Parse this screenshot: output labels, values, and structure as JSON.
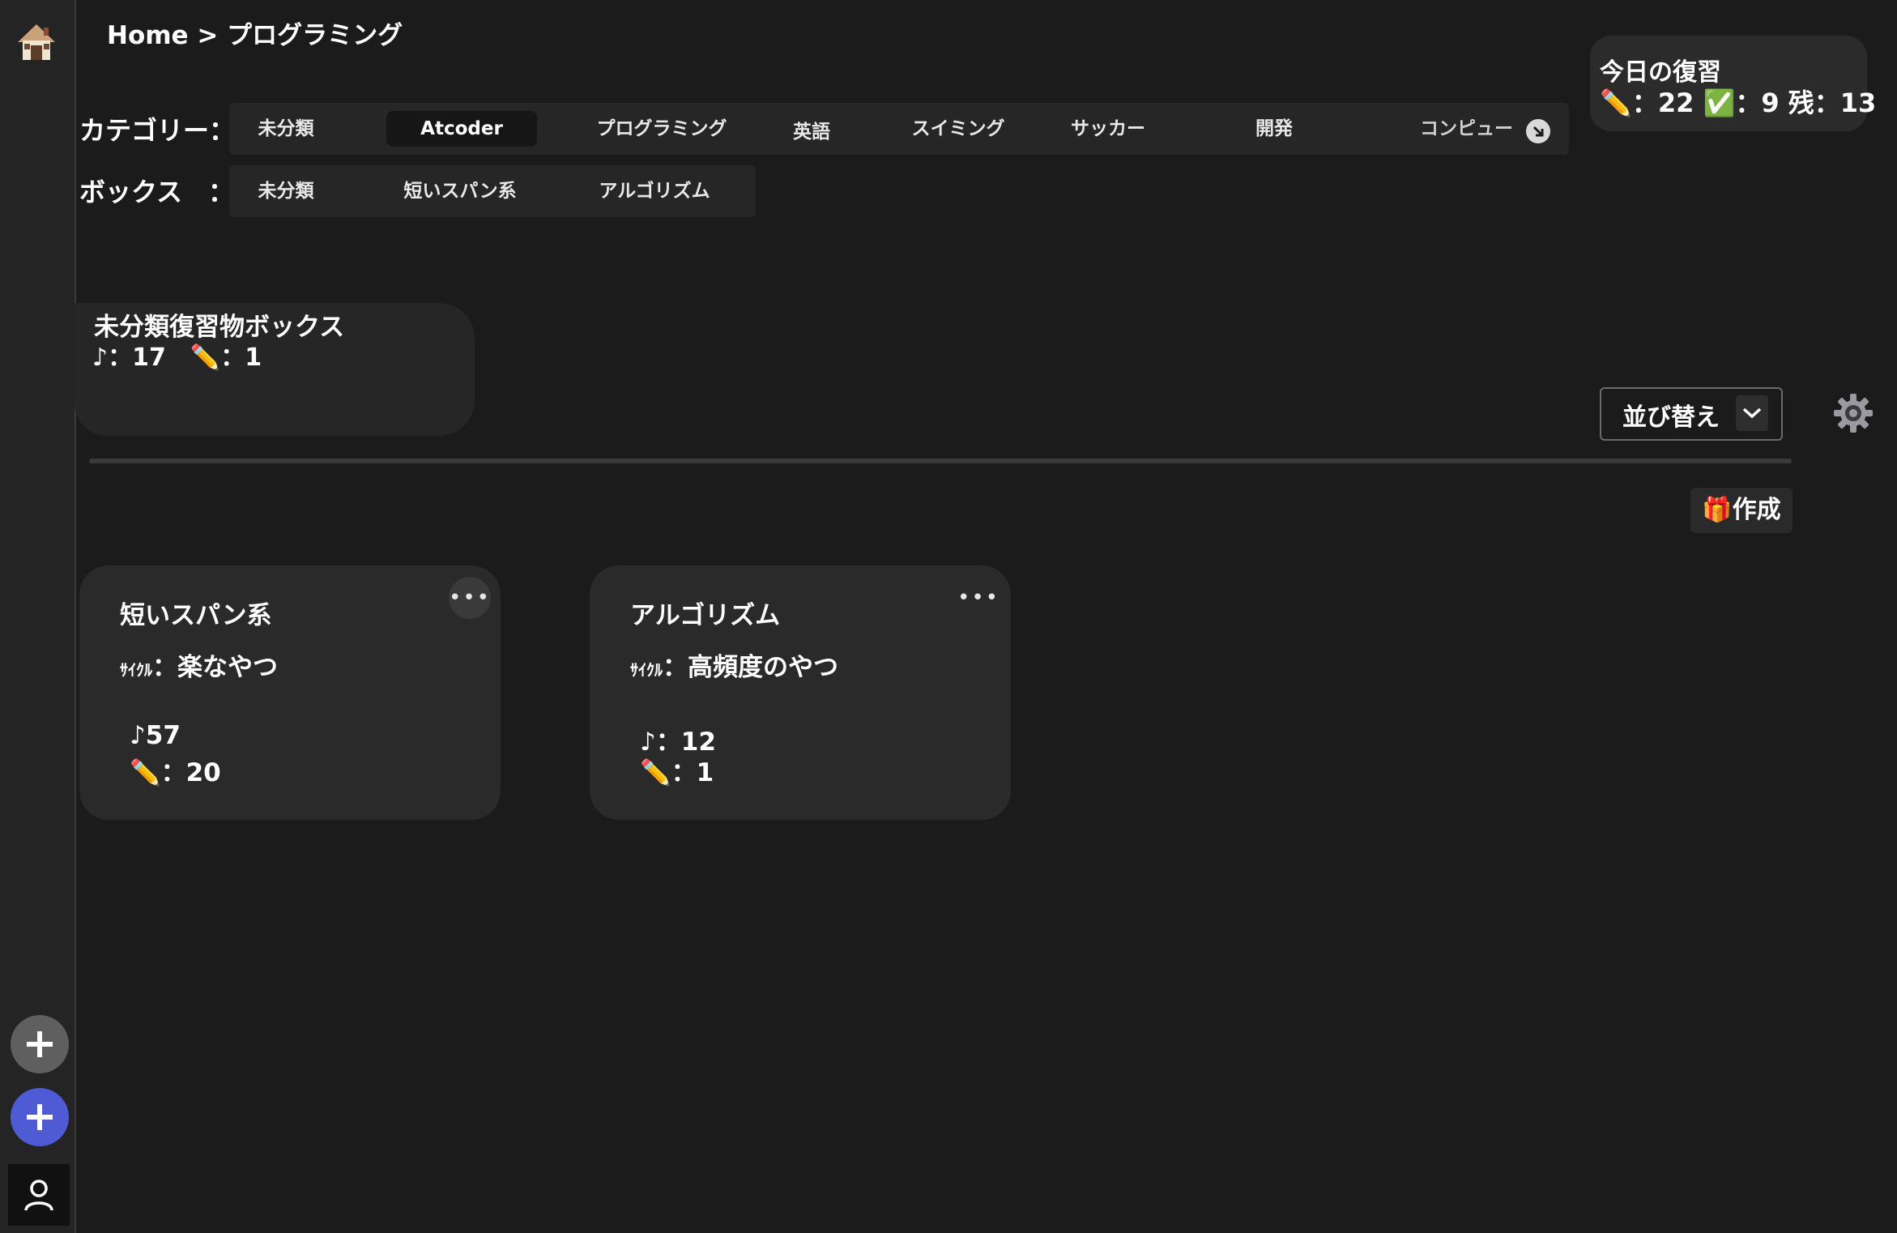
{
  "breadcrumb": "Home > プログラミング",
  "category_label": "カテゴリー：",
  "box_label": "ボックス　：",
  "categories": [
    {
      "label": "未分類"
    },
    {
      "label": "Atcoder",
      "active": true
    },
    {
      "label": "プログラミング"
    },
    {
      "label": "英語"
    },
    {
      "label": "スイミング"
    },
    {
      "label": "サッカー"
    },
    {
      "label": "開発"
    },
    {
      "label": "コンピュー"
    }
  ],
  "boxes_tabs": [
    {
      "label": "未分類"
    },
    {
      "label": "短いスパン系"
    },
    {
      "label": "アルゴリズム"
    }
  ],
  "today": {
    "title": "今日の復習",
    "stats": "✏️：22 ✅：9  残：13"
  },
  "uncategorized_box": {
    "title": "未分類復習物ボックス",
    "stats": "♪：17　✏️：1"
  },
  "sort": {
    "label": "並び替え"
  },
  "create": {
    "label": "🎁作成"
  },
  "cards": [
    {
      "title": "短いスパン系",
      "cycle_prefix": "ｻｲｸﾙ",
      "cycle_value": "：楽なやつ",
      "notes": "♪57",
      "pencil": "✏️：20"
    },
    {
      "title": "アルゴリズム",
      "cycle_prefix": "ｻｲｸﾙ",
      "cycle_value": "：高頻度のやつ",
      "notes": "♪：12",
      "pencil": "✏️：1"
    }
  ],
  "icons": {
    "logo": "house-logo-icon",
    "add_gray": "plus-icon",
    "add_blue": "plus-icon",
    "user": "user-icon",
    "scroll": "arrow-down-right-icon",
    "chevron": "chevron-down-icon",
    "gear": "gear-icon",
    "more": "ellipsis-icon"
  },
  "colors": {
    "background": "#1b1b1b",
    "accent": "#4f5bd5",
    "panel": "#2a2a2a"
  }
}
